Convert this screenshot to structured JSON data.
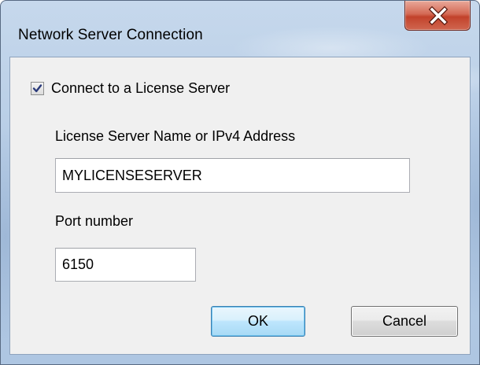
{
  "window": {
    "title": "Network Server Connection",
    "close_icon": "close-x-icon"
  },
  "form": {
    "connect_checkbox": {
      "label": "Connect to a License Server",
      "checked": true
    },
    "server_name": {
      "label": "License Server Name or IPv4 Address",
      "value": "MYLICENSESERVER"
    },
    "port": {
      "label": "Port number",
      "value": "6150"
    }
  },
  "buttons": {
    "ok_label": "OK",
    "cancel_label": "Cancel"
  },
  "colors": {
    "close_button": "#c8472f",
    "default_button_border": "#3c7fb1",
    "checkmark": "#2a3a7a"
  }
}
